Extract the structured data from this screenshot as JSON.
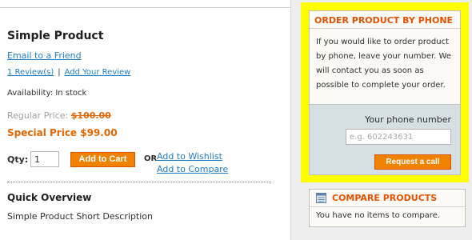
{
  "product": {
    "name": "Simple Product",
    "email_friend": "Email to a Friend",
    "reviews_link": "1 Review(s)",
    "separator": "|",
    "add_review": "Add Your Review",
    "availability": "Availability: In stock",
    "regular_price_label": "Regular Price:",
    "regular_price_value": "$100.00",
    "special_price": "Special Price $99.00",
    "qty_label": "Qty:",
    "qty_value": "1",
    "add_to_cart": "Add to Cart",
    "or_label": "OR",
    "add_to_wishlist": "Add to Wishlist",
    "add_to_compare": "Add to Compare",
    "overview_title": "Quick Overview",
    "overview_text": "Simple Product Short Description"
  },
  "phone_order": {
    "title": "ORDER PRODUCT BY PHONE",
    "text": "If you would like to order product by phone, leave your number. We will contact you as soon as possible to complete your order.",
    "phone_label": "Your phone number",
    "phone_placeholder": "e.g. 602243631",
    "request_button": "Request a call",
    "highlight_color": "#ffff00"
  },
  "compare": {
    "title": "COMPARE PRODUCTS",
    "icon": "compare-list-icon",
    "empty_text": "You have no items to compare."
  },
  "colors": {
    "accent": "#e25203",
    "button": "#f18200",
    "link": "#1e7ec8"
  }
}
